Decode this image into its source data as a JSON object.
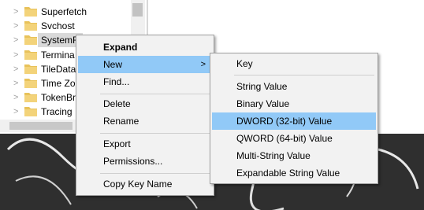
{
  "tree": {
    "items": [
      {
        "label": "Superfetch",
        "selected": false
      },
      {
        "label": "Svchost",
        "selected": false
      },
      {
        "label": "SystemR",
        "selected": true
      },
      {
        "label": "Termina",
        "selected": false
      },
      {
        "label": "TileData",
        "selected": false
      },
      {
        "label": "Time Zo",
        "selected": false
      },
      {
        "label": "TokenBr",
        "selected": false
      },
      {
        "label": "Tracing",
        "selected": false
      }
    ],
    "expand_glyph": ">"
  },
  "context_menu": {
    "expand": "Expand",
    "new": "New",
    "find": "Find...",
    "delete": "Delete",
    "rename": "Rename",
    "export": "Export",
    "permissions": "Permissions...",
    "copy_key_name": "Copy Key Name",
    "submenu_arrow": ">"
  },
  "new_submenu": {
    "key": "Key",
    "string_value": "String Value",
    "binary_value": "Binary Value",
    "dword_value": "DWORD (32-bit) Value",
    "qword_value": "QWORD (64-bit) Value",
    "multi_string_value": "Multi-String Value",
    "expandable_string_value": "Expandable String Value"
  },
  "colors": {
    "highlight": "#91c9f7",
    "menu_background": "#f2f2f2",
    "folder": "#e8c25a",
    "wallpaper": "#2f2f2f"
  }
}
